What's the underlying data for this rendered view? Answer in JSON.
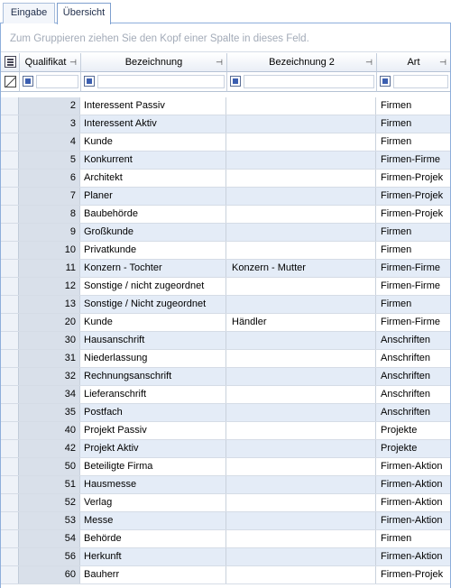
{
  "tabs": [
    {
      "label": "Eingabe",
      "active": false
    },
    {
      "label": "Übersicht",
      "active": true
    }
  ],
  "group_hint": "Zum Gruppieren ziehen Sie den Kopf einer Spalte in dieses Feld.",
  "columns": {
    "qualifikat": "Qualifikat",
    "bezeichnung": "Bezeichnung",
    "bezeichnung2": "Bezeichnung 2",
    "art": "Art"
  },
  "pin_glyph": "⊣",
  "colors": {
    "alt_row": "#e4ecf7",
    "header_border": "#8eaedb"
  },
  "rows": [
    {
      "q": "2",
      "b": "Interessent Passiv",
      "b2": "",
      "a": "Firmen"
    },
    {
      "q": "3",
      "b": "Interessent Aktiv",
      "b2": "",
      "a": "Firmen"
    },
    {
      "q": "4",
      "b": "Kunde",
      "b2": "",
      "a": "Firmen"
    },
    {
      "q": "5",
      "b": "Konkurrent",
      "b2": "",
      "a": "Firmen-Firme"
    },
    {
      "q": "6",
      "b": "Architekt",
      "b2": "",
      "a": "Firmen-Projek"
    },
    {
      "q": "7",
      "b": "Planer",
      "b2": "",
      "a": "Firmen-Projek"
    },
    {
      "q": "8",
      "b": "Baubehörde",
      "b2": "",
      "a": "Firmen-Projek"
    },
    {
      "q": "9",
      "b": "Großkunde",
      "b2": "",
      "a": "Firmen"
    },
    {
      "q": "10",
      "b": "Privatkunde",
      "b2": "",
      "a": "Firmen"
    },
    {
      "q": "11",
      "b": "Konzern - Tochter",
      "b2": "Konzern - Mutter",
      "a": "Firmen-Firme"
    },
    {
      "q": "12",
      "b": "Sonstige / nicht zugeordnet",
      "b2": "",
      "a": "Firmen-Firme"
    },
    {
      "q": "13",
      "b": "Sonstige / Nicht zugeordnet",
      "b2": "",
      "a": "Firmen"
    },
    {
      "q": "20",
      "b": "Kunde",
      "b2": "Händler",
      "a": "Firmen-Firme"
    },
    {
      "q": "30",
      "b": "Hausanschrift",
      "b2": "",
      "a": "Anschriften"
    },
    {
      "q": "31",
      "b": "Niederlassung",
      "b2": "",
      "a": "Anschriften"
    },
    {
      "q": "32",
      "b": "Rechnungsanschrift",
      "b2": "",
      "a": "Anschriften"
    },
    {
      "q": "34",
      "b": "Lieferanschrift",
      "b2": "",
      "a": "Anschriften"
    },
    {
      "q": "35",
      "b": "Postfach",
      "b2": "",
      "a": "Anschriften"
    },
    {
      "q": "40",
      "b": "Projekt Passiv",
      "b2": "",
      "a": "Projekte"
    },
    {
      "q": "42",
      "b": "Projekt Aktiv",
      "b2": "",
      "a": "Projekte"
    },
    {
      "q": "50",
      "b": "Beteiligte Firma",
      "b2": "",
      "a": "Firmen-Aktion"
    },
    {
      "q": "51",
      "b": "Hausmesse",
      "b2": "",
      "a": "Firmen-Aktion"
    },
    {
      "q": "52",
      "b": "Verlag",
      "b2": "",
      "a": "Firmen-Aktion"
    },
    {
      "q": "53",
      "b": "Messe",
      "b2": "",
      "a": "Firmen-Aktion"
    },
    {
      "q": "54",
      "b": "Behörde",
      "b2": "",
      "a": "Firmen"
    },
    {
      "q": "56",
      "b": "Herkunft",
      "b2": "",
      "a": "Firmen-Aktion"
    },
    {
      "q": "60",
      "b": "Bauherr",
      "b2": "",
      "a": "Firmen-Projek"
    }
  ]
}
